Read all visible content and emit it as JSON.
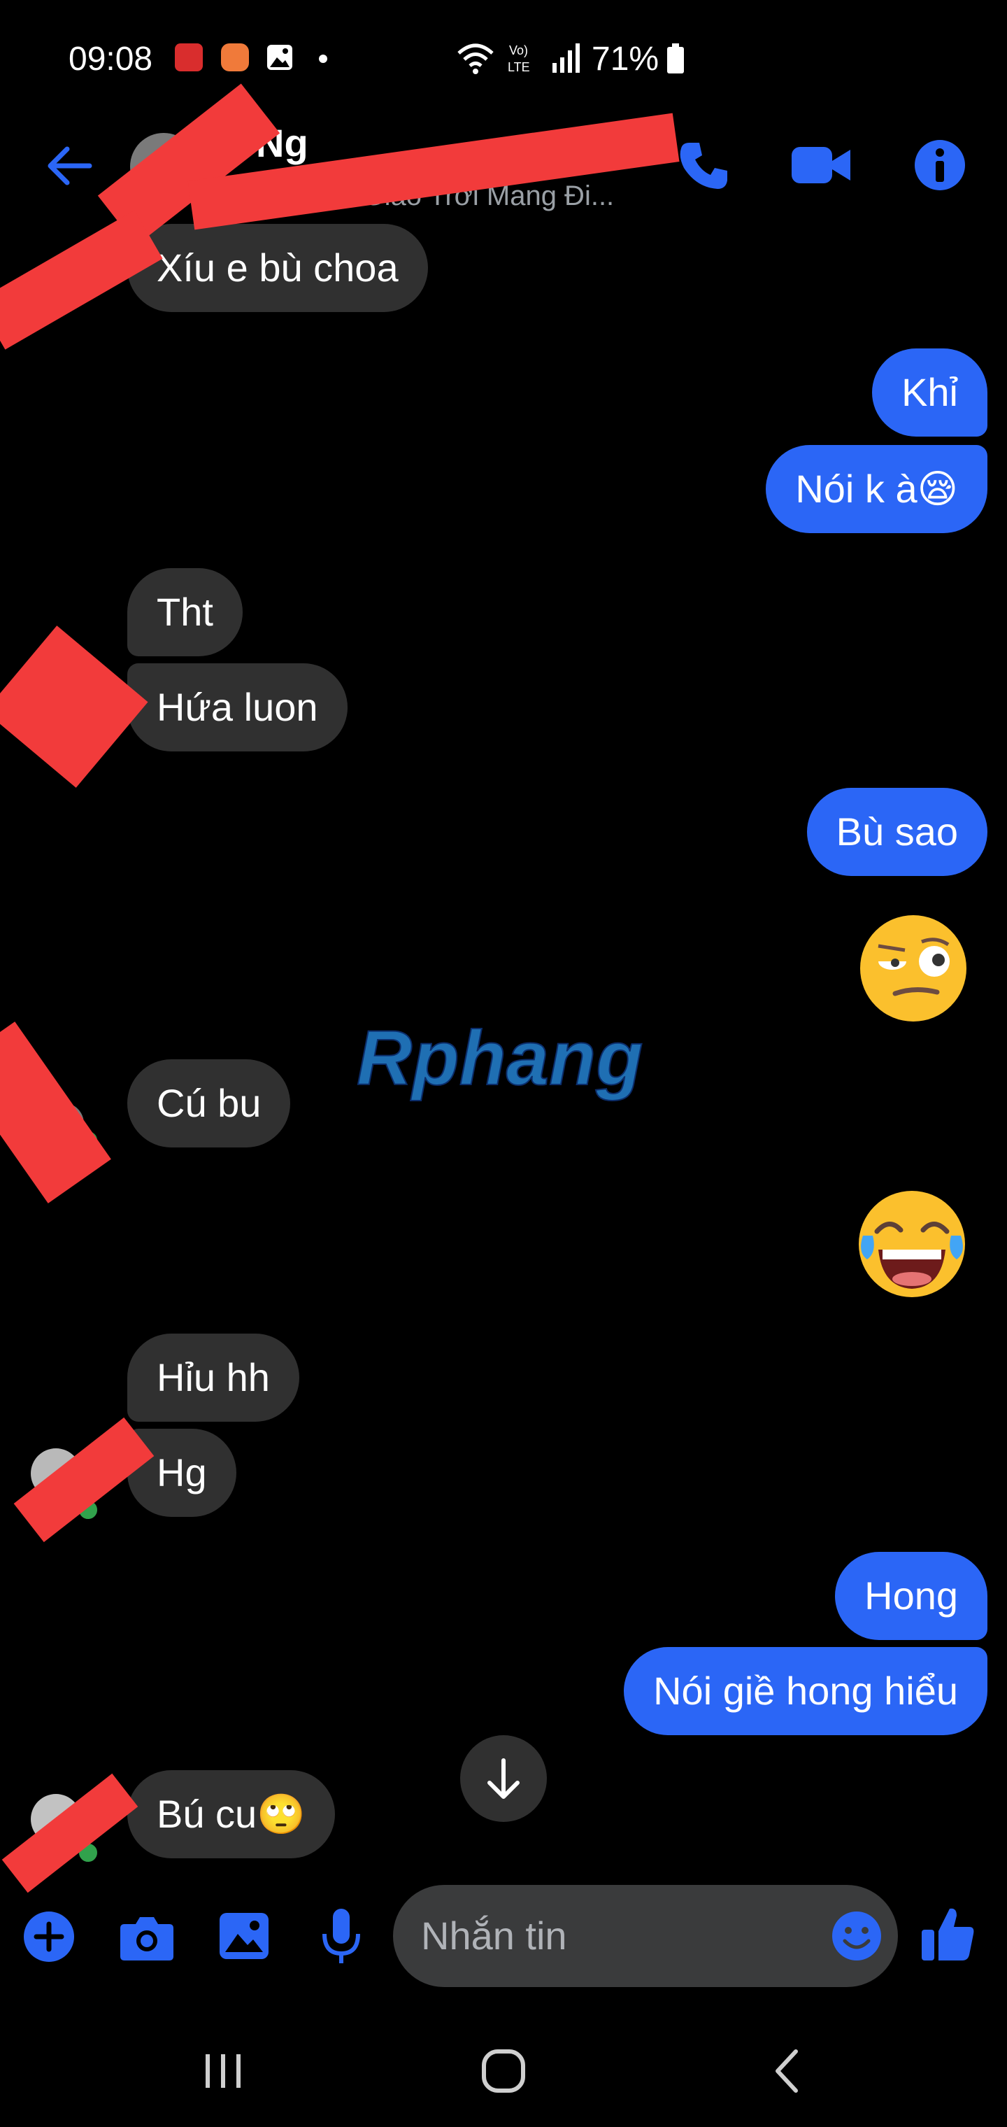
{
  "status_bar": {
    "time": "09:08",
    "battery": "71%",
    "icons": [
      "app-notification-icon",
      "flower-app-icon",
      "gallery-icon",
      "dot-icon",
      "wifi-icon",
      "volte-icon",
      "signal-icon",
      "battery-icon"
    ]
  },
  "header": {
    "name": "Ng",
    "subtitle": "Trời Giáo Trời Mang Đi...",
    "icons": [
      "back-arrow-icon",
      "phone-icon",
      "video-icon",
      "info-icon"
    ],
    "accent": "#2b66f6"
  },
  "messages": [
    {
      "side": "in",
      "text": "Xíu e bù choa"
    },
    {
      "side": "out",
      "text": "Khỉ"
    },
    {
      "side": "out",
      "text": "Nói k à😪"
    },
    {
      "side": "in",
      "text": "Tht"
    },
    {
      "side": "in",
      "text": "Hứa luon"
    },
    {
      "side": "out",
      "text": "Bù sao"
    },
    {
      "side": "out",
      "emoji": "smirk-face"
    },
    {
      "side": "in",
      "text": "Cú bu"
    },
    {
      "side": "out",
      "emoji": "laughing-tears-face"
    },
    {
      "side": "in",
      "text": "Hỉu hh"
    },
    {
      "side": "in",
      "text": "Hg"
    },
    {
      "side": "out",
      "text": "Hong"
    },
    {
      "side": "out",
      "text": "Nói giề hong hiểu"
    },
    {
      "side": "in",
      "text": "Bú cu🙄"
    }
  ],
  "watermark": "Rphang",
  "composer": {
    "placeholder": "Nhắn tin",
    "icons": [
      "plus-icon",
      "camera-icon",
      "gallery-icon",
      "microphone-icon",
      "emoji-icon",
      "like-icon"
    ]
  },
  "colors": {
    "outgoing_bubble": "#2b66f6",
    "incoming_bubble": "#303030",
    "background": "#000000",
    "online": "#31a24c"
  }
}
